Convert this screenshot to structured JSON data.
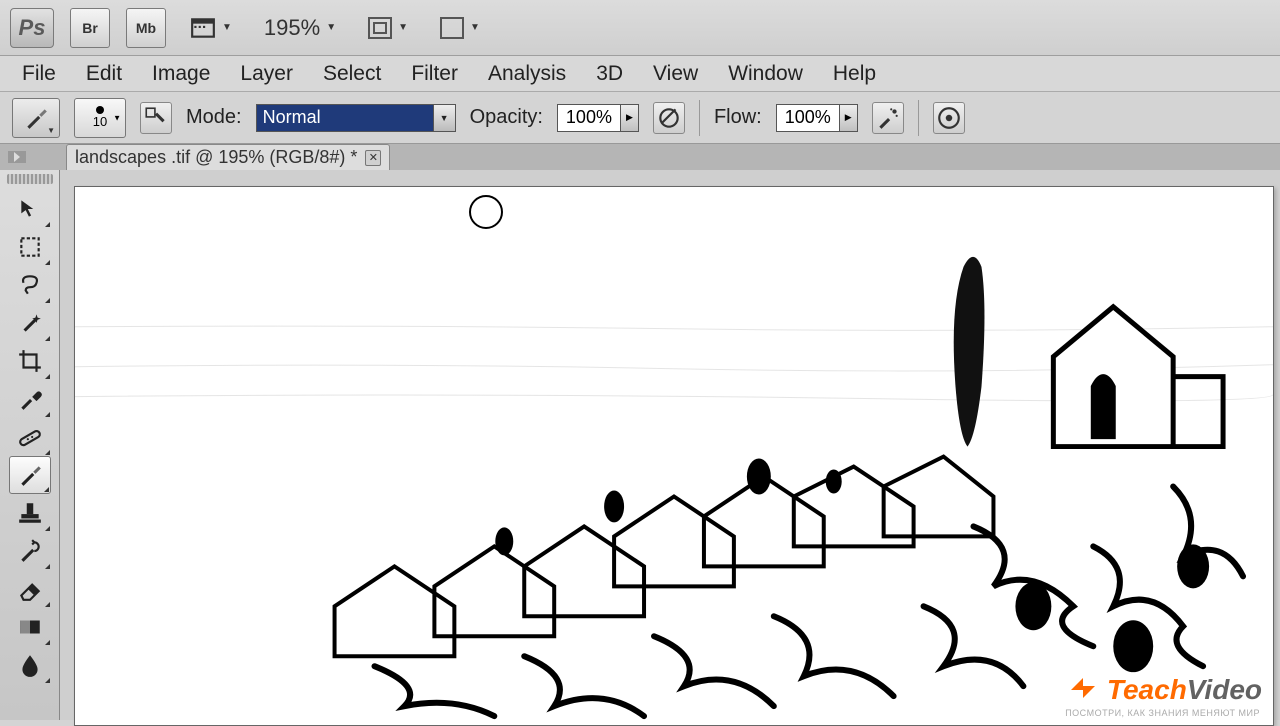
{
  "appBar": {
    "logo": "Ps",
    "bridge": "Br",
    "miniBridge": "Mb",
    "zoom": "195%"
  },
  "menu": {
    "items": [
      "File",
      "Edit",
      "Image",
      "Layer",
      "Select",
      "Filter",
      "Analysis",
      "3D",
      "View",
      "Window",
      "Help"
    ]
  },
  "options": {
    "brushSize": "10",
    "modeLabel": "Mode:",
    "modeValue": "Normal",
    "opacityLabel": "Opacity:",
    "opacityValue": "100%",
    "flowLabel": "Flow:",
    "flowValue": "100%"
  },
  "document": {
    "tabTitle": "landscapes .tif @ 195% (RGB/8#) *"
  },
  "watermark": {
    "brand1": "Teach",
    "brand2": "Video",
    "sub": "ПОСМОТРИ, КАК ЗНАНИЯ МЕНЯЮТ МИР"
  }
}
